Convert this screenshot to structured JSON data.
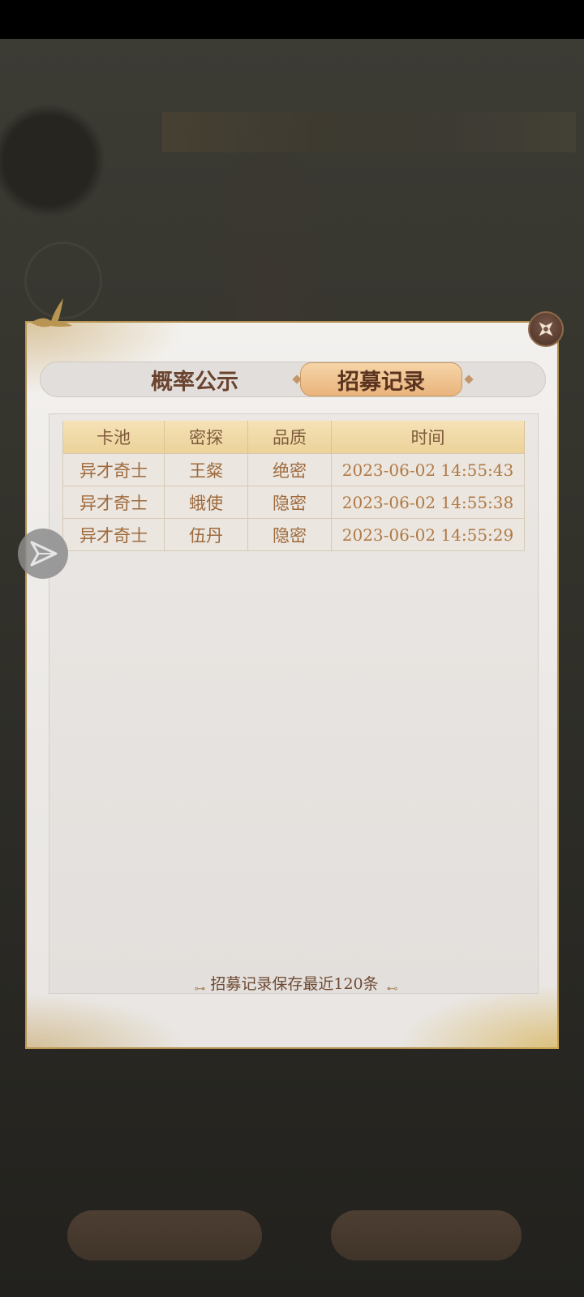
{
  "tabs": [
    {
      "label": "概率公示",
      "active": false
    },
    {
      "label": "招募记录",
      "active": true
    }
  ],
  "table": {
    "headers": [
      "卡池",
      "密探",
      "品质",
      "时间"
    ],
    "rows": [
      {
        "pool": "异才奇士",
        "agent": "王粲",
        "quality": "绝密",
        "time": "2023-06-02 14:55:43"
      },
      {
        "pool": "异才奇士",
        "agent": "蛾使",
        "quality": "隐密",
        "time": "2023-06-02 14:55:38"
      },
      {
        "pool": "异才奇士",
        "agent": "伍丹",
        "quality": "隐密",
        "time": "2023-06-02 14:55:29"
      }
    ]
  },
  "footer_note": "招募记录保存最近120条",
  "colors": {
    "quality_top": "#c24c2c",
    "quality_hidden": "#6fa3c9",
    "active_tab": "#e9b47c",
    "frame_gold": "#b08d4c"
  },
  "icons": {
    "close": "close-icon",
    "float": "play-triangle-icon",
    "corner": "bird-icon"
  }
}
